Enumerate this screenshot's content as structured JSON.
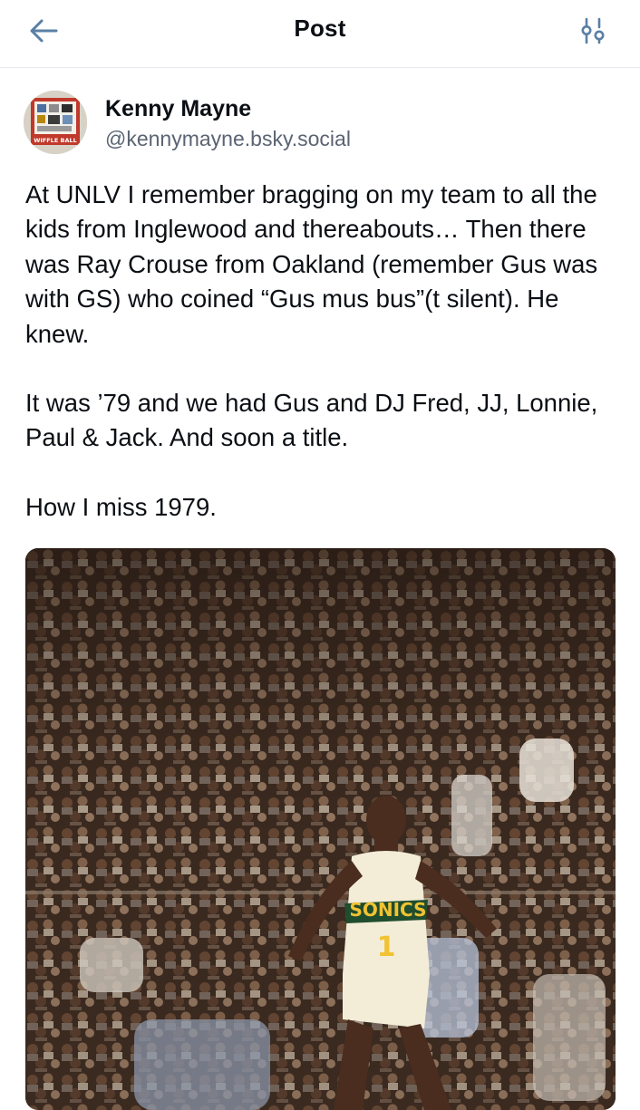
{
  "header": {
    "title": "Post",
    "back_icon": "arrow-left-icon",
    "filter_icon": "sliders-icon"
  },
  "post": {
    "author": {
      "display_name": "Kenny Mayne",
      "handle": "@kennymayne.bsky.social",
      "avatar_icon": "avatar-image",
      "avatar_text": "WIFFLE BALL"
    },
    "paragraphs": [
      "At UNLV I remember bragging on my team to all the kids from Inglewood and thereabouts… Then there was Ray Crouse from Oakland (remember Gus was with GS) who coined “Gus mus bus”(t silent). He knew.",
      "It was ’79 and we had Gus and DJ Fred, JJ, Lonnie, Paul & Jack. And soon a title.",
      "How I miss 1979."
    ],
    "image": {
      "jersey_text": "SONICS",
      "jersey_number": "1"
    }
  },
  "colors": {
    "accent": "#5a7fa6",
    "text": "#0b0f14",
    "muted": "#5a6472",
    "divider": "#e6e9ee"
  }
}
